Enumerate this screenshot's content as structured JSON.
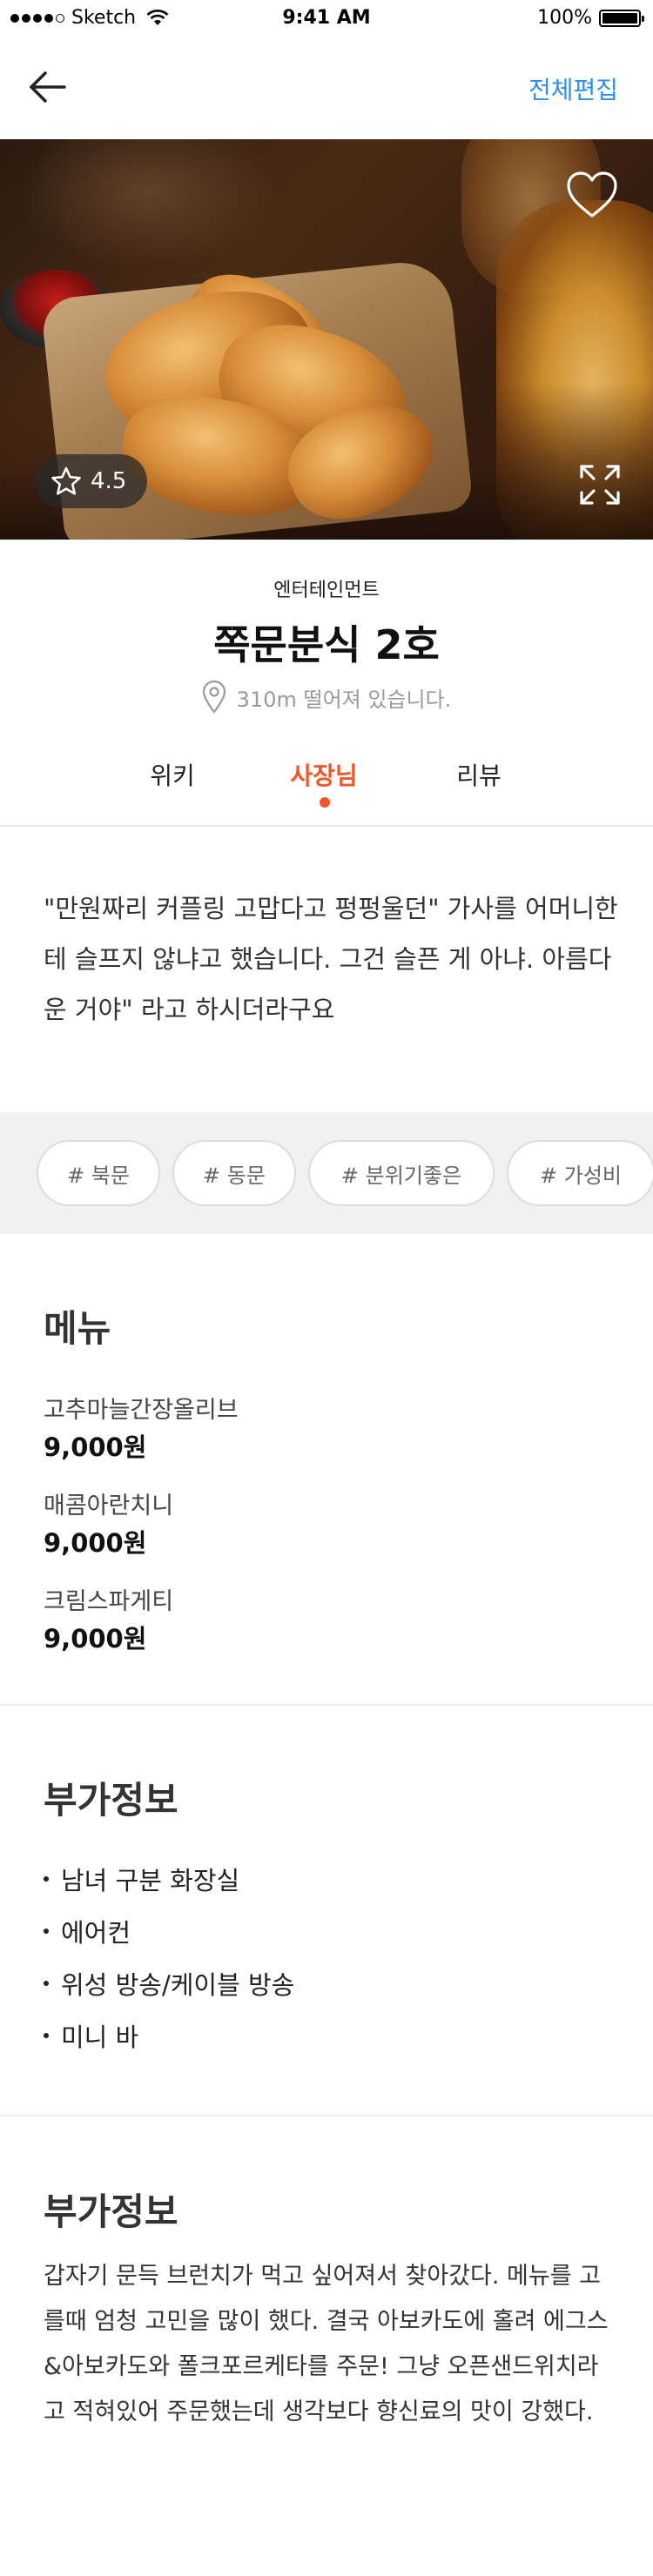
{
  "status_bar": {
    "carrier": "Sketch",
    "time": "9:41 AM",
    "battery": "100%",
    "battery_level": 1.0
  },
  "nav": {
    "back_icon": "arrow-left-icon",
    "edit_all": "전체편집"
  },
  "hero": {
    "favorite_icon": "heart-outline-icon",
    "rating_icon": "star-outline-icon",
    "rating": "4.5",
    "expand_icon": "expand-icon"
  },
  "store": {
    "category": "엔터테인먼트",
    "name": "쪽문분식 2호",
    "location_icon": "map-pin-icon",
    "distance": "310m 떨어져 있습니다."
  },
  "tabs": [
    {
      "label": "위키"
    },
    {
      "label": "사장님",
      "active": true
    },
    {
      "label": "리뷰"
    }
  ],
  "quote": "\"만원짜리 커플링 고맙다고 펑펑울던\" 가사를 어머니한테 슬프지 않냐고 했습니다. 그건 슬픈 게 아냐. 아름다운 거야\" 라고 하시더라구요",
  "tags": [
    "# 북문",
    "# 동문",
    "# 분위기좋은",
    "# 가성비"
  ],
  "menu": {
    "title": "메뉴",
    "items": [
      {
        "name": "고추마늘간장올리브",
        "price": "9,000원"
      },
      {
        "name": "매콤아란치니",
        "price": "9,000원"
      },
      {
        "name": "크림스파게티",
        "price": "9,000원"
      }
    ]
  },
  "extra_info": {
    "title": "부가정보",
    "items": [
      "남녀 구분 화장실",
      "에어컨",
      "위성 방송/케이블 방송",
      "미니 바"
    ]
  },
  "extra_desc": {
    "title": "부가정보",
    "text": "갑자기 문득 브런치가 먹고 싶어져서 찾아갔다. 메뉴를 고를때 엄청 고민을 많이 했다. 결국 아보카도에 홀려 에그스&아보카도와 폴크포르케타를 주문! 그냥 오픈샌드위치라고 적혀있어 주문했는데 생각보다 향신료의 맛이 강했다."
  },
  "colors": {
    "accent": "#f0582b",
    "link": "#2f8eea",
    "tag_strip_bg": "#f1f1f1"
  }
}
